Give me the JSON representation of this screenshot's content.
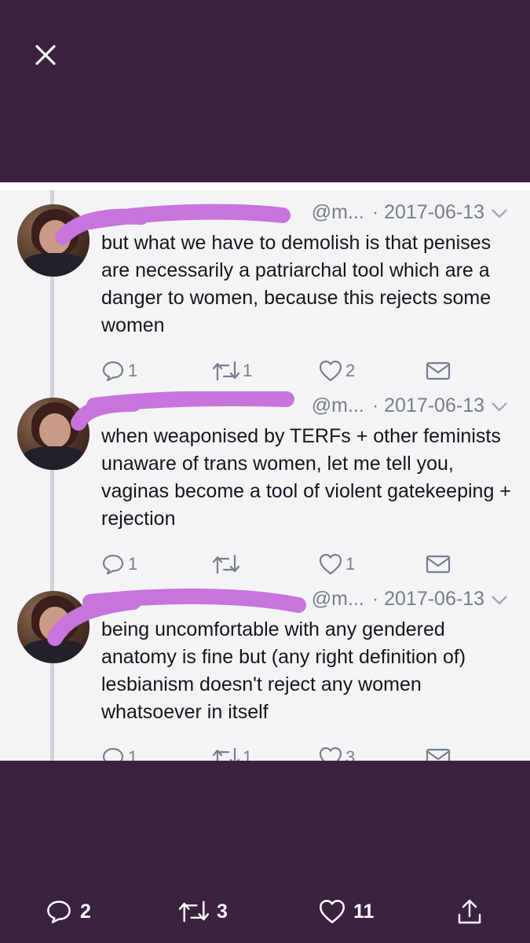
{
  "viewer": {
    "close_icon": "close-icon",
    "footer": {
      "replies": "2",
      "retweets": "3",
      "likes": "11",
      "share_icon": "share-icon"
    }
  },
  "tweets": [
    {
      "handle": "@m...",
      "date": "· 2017-06-13",
      "text": "but what we have to demolish is that penises are necessarily a patriarchal tool which are a danger to women, because this rejects some women",
      "replies": "1",
      "retweets": "1",
      "likes": "2"
    },
    {
      "handle": "@m...",
      "date": "· 2017-06-13",
      "text": "when weaponised by TERFs + other feminists unaware of trans women, let me tell you, vaginas become a tool of violent gatekeeping + rejection",
      "replies": "1",
      "retweets": "",
      "likes": "1"
    },
    {
      "handle": "@m...",
      "date": "· 2017-06-13",
      "text": "being uncomfortable with any gendered anatomy is fine but (any right definition of) lesbianism doesn't reject any women whatsoever in itself",
      "replies": "1",
      "retweets": "1",
      "likes": "3"
    }
  ],
  "colors": {
    "viewer_bg": "#3b2240",
    "scribble": "#c774dd",
    "secondary_text": "#74808c"
  }
}
